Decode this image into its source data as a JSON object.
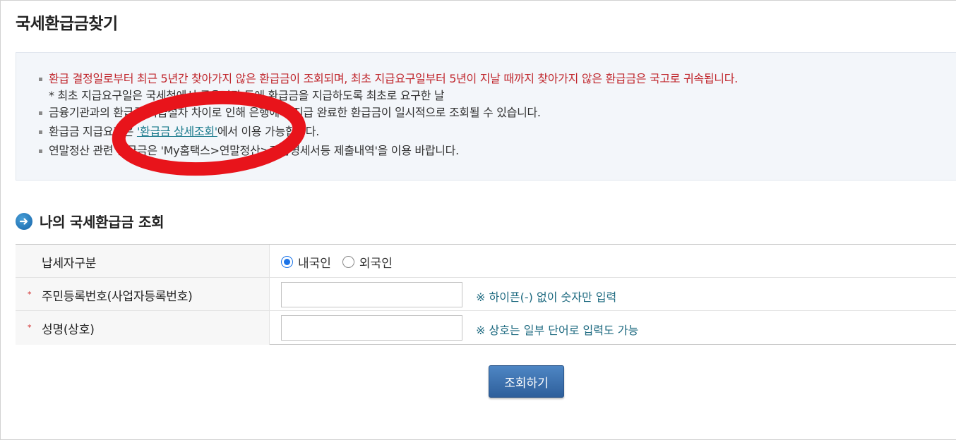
{
  "page_title": "국세환급금찾기",
  "notices": [
    {
      "text": "환급 결정일로부터 최근 5년간 찾아가지 않은 환급금이 조회되며, 최초 지급요구일부터 5년이 지날 때까지 찾아가지 않은 환급금은 국고로 귀속됩니다.",
      "color": "#c0272d"
    },
    {
      "text": "* 최초 지급요구일은 국세청에서 금융기관 등에 환급금을 지급하도록 최초로 요구한 날"
    },
    {
      "text": "금융기관과의 환급금 지급절차 차이로 인해 은행에서 지급 완료한 환급금이 일시적으로 조회될 수 있습니다."
    },
    {
      "prefix": "환급금 지급요청은 ",
      "link": "'환급금 상세조회'",
      "suffix": "에서 이용 가능합니다."
    },
    {
      "text": "연말정산 관련 환급금은 'My홈택스>연말정산>지급명세서등 제출내역'을 이용 바랍니다."
    }
  ],
  "section_title": "나의 국세환급금 조회",
  "form": {
    "taxpayer_type_label": "납세자구분",
    "options": [
      "내국인",
      "외국인"
    ],
    "selected_option": "내국인",
    "id_label": "주민등록번호(사업자등록번호)",
    "id_value": "",
    "id_hint": "※ 하이픈(-) 없이 숫자만 입력",
    "name_label": "성명(상호)",
    "name_value": "",
    "name_hint": "※ 상호는 일부 단어로 입력도 가능",
    "required_mark": "*"
  },
  "search_button": "조회하기",
  "colors": {
    "notice_red": "#c0272d",
    "hint_teal": "#1e6a80",
    "button_blue": "#3a6fad",
    "annotation_red": "#e8141b"
  }
}
